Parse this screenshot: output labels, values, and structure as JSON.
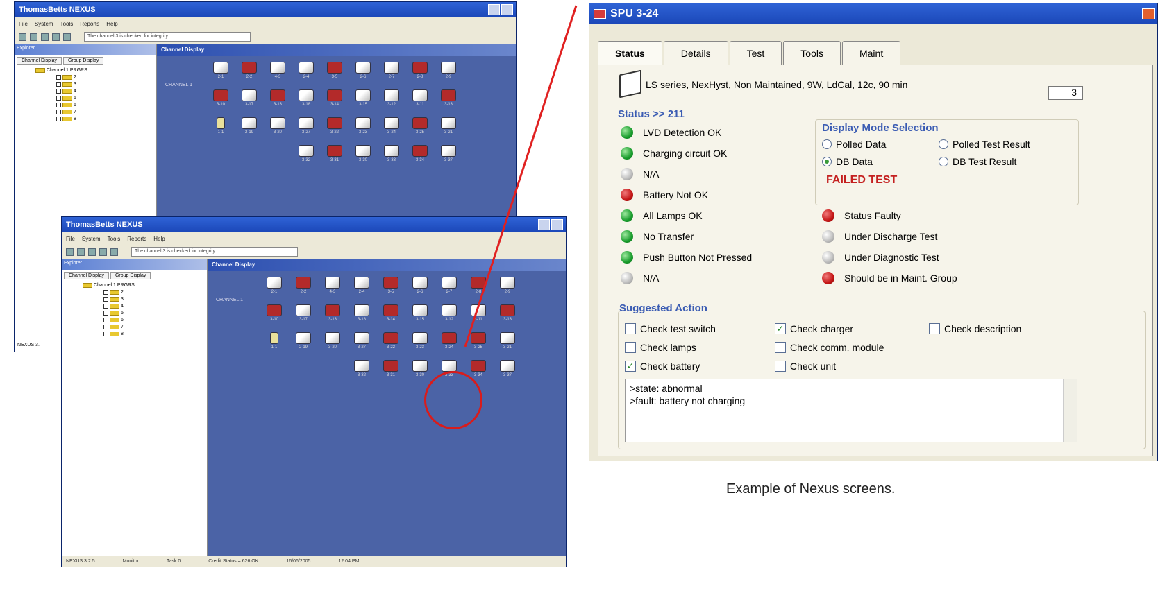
{
  "app_window": {
    "title": "ThomasBetts NEXUS",
    "menu": [
      "File",
      "System",
      "Tools",
      "Reports",
      "Help"
    ],
    "message": "The channel 3 is checked for integrity",
    "explorer_header": "Explorer",
    "explorer_tabs": [
      "Channel Display",
      "Group Display"
    ],
    "tree_root": "Channel 1 PRGRS",
    "tree_items": [
      "2",
      "3",
      "4",
      "5",
      "6",
      "7",
      "8"
    ],
    "channel_header": "Channel Display",
    "channel_label": "CHANNEL 1",
    "status_bar": [
      "NEXUS 3.2.5",
      "Monitor",
      "Task 0",
      "Credit Status = 626 OK",
      "16/06/2005",
      "12:04 PM"
    ],
    "status_short": "NEXUS 3."
  },
  "channel_cells": [
    [
      "2-1",
      "2-2",
      "4-3",
      "2-4",
      "3-5",
      "2-6",
      "2-7",
      "2-8",
      "2-9"
    ],
    [
      "3-10",
      "3-17",
      "3-13",
      "3-18",
      "3-14",
      "3-15",
      "3-12",
      "3-11",
      "3-13"
    ],
    [
      "1-1",
      "2-19",
      "3-20",
      "3-27",
      "3-22",
      "3-23",
      "3-24",
      "3-25",
      "3-21"
    ],
    [
      "3-32",
      "3-31",
      "3-30",
      "3-33",
      "3-34",
      "3-37"
    ]
  ],
  "dialog": {
    "title": "SPU 3-24",
    "tabs": [
      "Status",
      "Details",
      "Test",
      "Tools",
      "Maint"
    ],
    "description": "LS series, NexHyst, Non Maintained, 9W, LdCal, 12c, 90 min",
    "count": "3",
    "status_group_title": "Status >> 211",
    "status_items": [
      {
        "label": "LVD Detection OK",
        "color": "#189c2c"
      },
      {
        "label": "Charging circuit OK",
        "color": "#189c2c"
      },
      {
        "label": "N/A",
        "color": "#bbbbbb"
      },
      {
        "label": "Battery Not OK",
        "color": "#c41515"
      },
      {
        "label": "All Lamps OK",
        "color": "#189c2c"
      },
      {
        "label": "No Transfer",
        "color": "#189c2c"
      },
      {
        "label": "Push Button Not Pressed",
        "color": "#189c2c"
      },
      {
        "label": "N/A",
        "color": "#bbbbbb"
      }
    ],
    "display_mode_title": "Display Mode Selection",
    "display_modes": [
      "Polled Data",
      "Polled Test Result",
      "DB Data",
      "DB Test Result"
    ],
    "display_mode_selected": "DB Data",
    "failed_text": "FAILED TEST",
    "right_status": [
      {
        "label": "Status Faulty",
        "color": "#c41515"
      },
      {
        "label": "Under Discharge Test",
        "color": "#bbbbbb"
      },
      {
        "label": "Under Diagnostic Test",
        "color": "#bbbbbb"
      },
      {
        "label": "Should be in Maint. Group",
        "color": "#c41515"
      }
    ],
    "suggested_title": "Suggested Action",
    "actions": [
      {
        "label": "Check test switch",
        "checked": false
      },
      {
        "label": "Check charger",
        "checked": true
      },
      {
        "label": "Check description",
        "checked": false
      },
      {
        "label": "Check lamps",
        "checked": false
      },
      {
        "label": "Check comm. module",
        "checked": false
      },
      {
        "label": "Check battery",
        "checked": true
      },
      {
        "label": "Check unit",
        "checked": false
      }
    ],
    "memo_lines": [
      ">state: abnormal",
      ">fault: battery not charging"
    ]
  },
  "caption": "Example of Nexus screens."
}
